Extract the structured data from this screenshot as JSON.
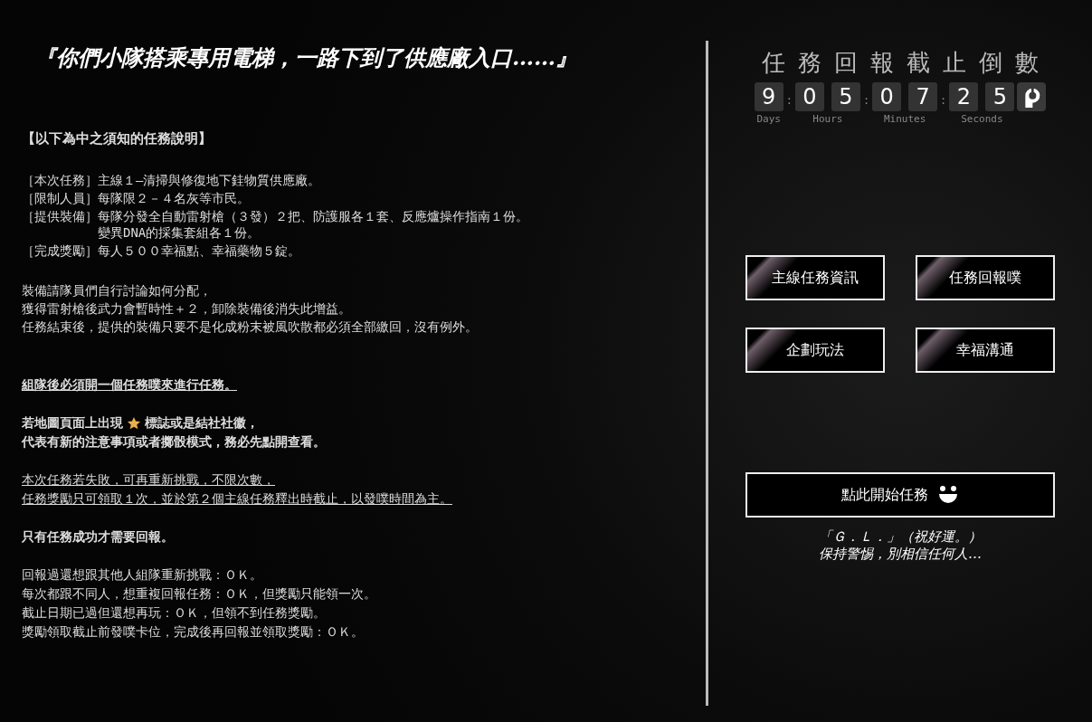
{
  "heading": "『你們小隊搭乘專用電梯，一路下到了供應廠入口……』",
  "briefing": {
    "title": "【以下為中之須知的任務說明】",
    "items": [
      {
        "label": "［本次任務］",
        "lines": [
          "主線１—清掃與修復地下銈物質供應廠。"
        ]
      },
      {
        "label": "［限制人員］",
        "lines": [
          "每隊限２－４名灰等市民。"
        ]
      },
      {
        "label": "［提供裝備］",
        "lines": [
          "每隊分發全自動雷射槍（３發）２把、防護服各１套、反應爐操作指南１份。",
          "變異DNA的採集套組各１份。"
        ]
      },
      {
        "label": "［完成獎勵］",
        "lines": [
          "每人５００幸福點、幸福藥物５錠。"
        ]
      }
    ],
    "notes": [
      "裝備請隊員們自行討論如何分配，",
      "獲得雷射槍後武力會暫時性＋２，卸除裝備後消失此增益。",
      "任務結束後，提供的裝備只要不是化成粉末被風吹散都必須全部繳回，沒有例外。"
    ]
  },
  "rules": [
    {
      "kind": "bold-underline",
      "lines": [
        "組隊後必須開一個任務噗來進行任務。"
      ]
    },
    {
      "kind": "star-notice",
      "lines": [
        "若地圖頁面上出現",
        "標誌或是結社社徽，",
        "代表有新的注意事項或者擲骰模式，務必先點開查看。"
      ]
    },
    {
      "kind": "underline",
      "lines": [
        "本次任務若失敗，可再重新挑戰，不限次數，",
        "任務獎勵只可領取１次，並於第２個主線任務釋出時截止，以發噗時間為主。"
      ]
    },
    {
      "kind": "bold",
      "lines": [
        "只有任務成功才需要回報。"
      ]
    },
    {
      "kind": "plain",
      "lines": [
        "回報過還想跟其他人組隊重新挑戰：ＯＫ。",
        "每次都跟不同人，想重複回報任務：ＯＫ，但獎勵只能領一次。",
        "截止日期已過但還想再玩：ＯＫ，但領不到任務獎勵。",
        "獎勵領取截止前發噗卡位，完成後再回報並領取獎勵：ＯＫ。"
      ]
    }
  ],
  "countdown": {
    "title": "任務回報截止倒數",
    "separator": ":",
    "units": [
      {
        "label": "Days",
        "digits": [
          "9"
        ]
      },
      {
        "label": "Hours",
        "digits": [
          "0",
          "5"
        ]
      },
      {
        "label": "Minutes",
        "digits": [
          "0",
          "7"
        ]
      },
      {
        "label": "Seconds",
        "digits": [
          "2",
          "5"
        ]
      }
    ]
  },
  "menu_buttons": [
    "主線任務資訊",
    "任務回報噗",
    "企劃玩法",
    "幸福溝通"
  ],
  "start_button": "點此開始任務",
  "footer": [
    "「Ｇ．Ｌ．」（祝好運。）",
    "保持警惕，別相信任何人…"
  ]
}
